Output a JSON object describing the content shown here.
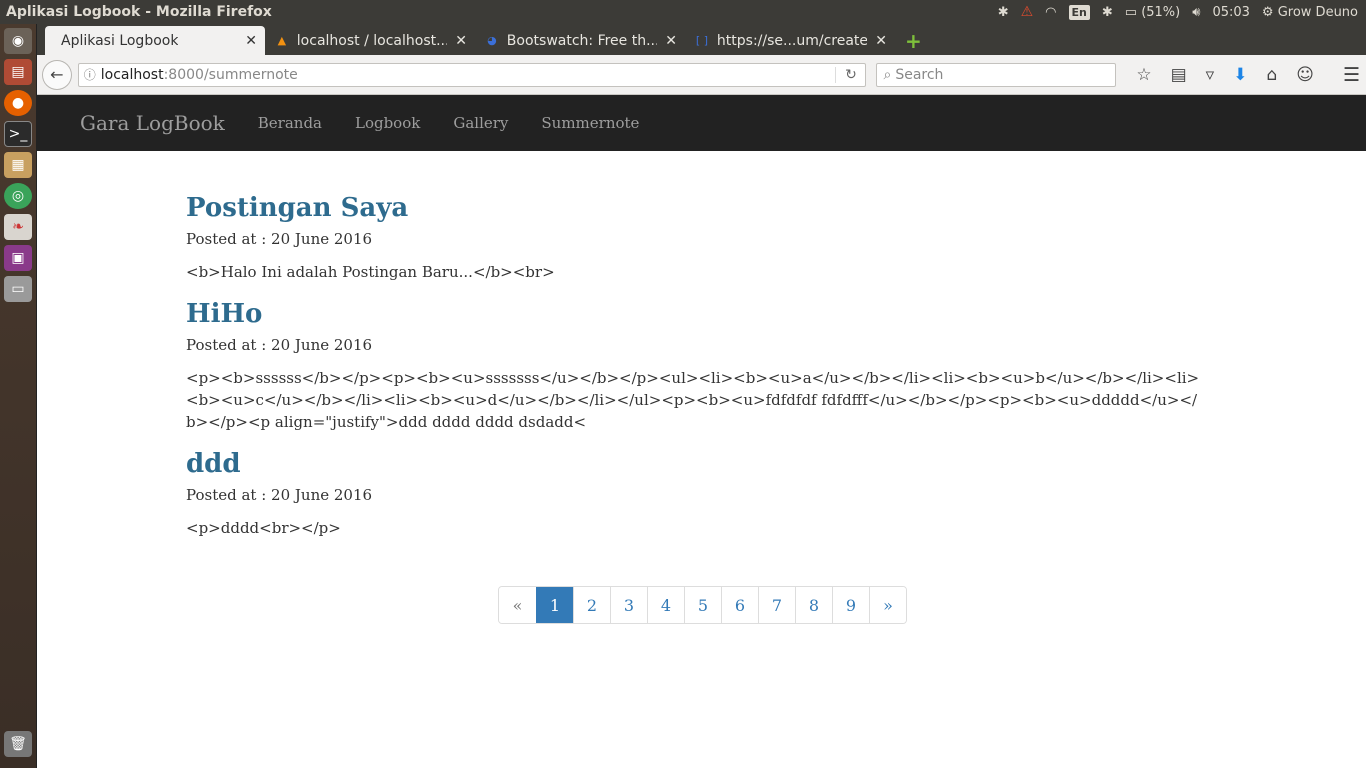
{
  "os": {
    "window_title": "Aplikasi Logbook - Mozilla Firefox",
    "keyboard": "En",
    "battery": "(51%)",
    "clock": "05:03",
    "user": "Grow Deuno"
  },
  "browser": {
    "tabs": [
      {
        "label": "Aplikasi Logbook",
        "active": true
      },
      {
        "label": "localhost / localhost...",
        "active": false
      },
      {
        "label": "Bootswatch: Free th...",
        "active": false
      },
      {
        "label": "https://se...um/create",
        "active": false
      }
    ],
    "url_host": "localhost",
    "url_path": ":8000/summernote",
    "search_placeholder": "Search"
  },
  "site": {
    "brand": "Gara LogBook",
    "nav": [
      "Beranda",
      "Logbook",
      "Gallery",
      "Summernote"
    ]
  },
  "posts": [
    {
      "title": "Postingan Saya",
      "meta": "Posted at : 20 June 2016",
      "body": "<b>Halo Ini adalah Postingan Baru...</b><br>"
    },
    {
      "title": "HiHo",
      "meta": "Posted at : 20 June 2016",
      "body": "<p><b>ssssss</b></p><p><b><u>sssssss</u></b></p><ul><li><b><u>a</u></b></li><li><b><u>b</u></b></li><li><b><u>c</u></b></li><li><b><u>d</u></b></li></ul><p><b><u>fdfdfdf fdfdfff</u></b></p><p><b><u>ddddd</u></b></p><p align=\"justify\">ddd dddd dddd dsdadd<"
    },
    {
      "title": "ddd",
      "meta": "Posted at : 20 June 2016",
      "body": "<p>dddd<br></p>"
    }
  ],
  "pagination": {
    "prev": "«",
    "pages": [
      "1",
      "2",
      "3",
      "4",
      "5",
      "6",
      "7",
      "8",
      "9"
    ],
    "next": "»",
    "active": "1"
  }
}
